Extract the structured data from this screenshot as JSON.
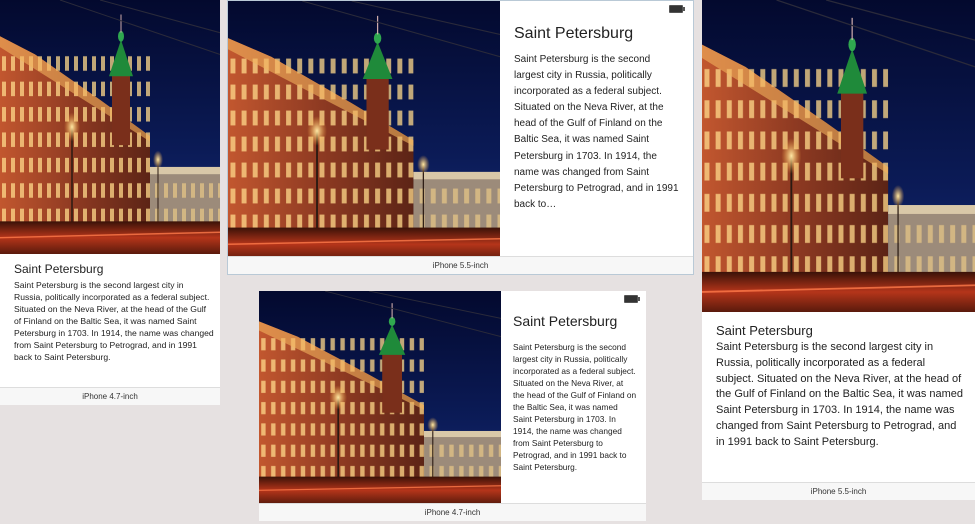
{
  "city": {
    "title": "Saint Petersburg",
    "description": "Saint Petersburg is the second largest city in Russia, politically incorporated as a federal subject. Situated on the Neva River, at the head of the Gulf of Finland on the Baltic Sea, it was named Saint Petersburg in 1703. In 1914, the name was changed from Saint Petersburg to Petrograd, and in 1991 back to Saint Petersburg.",
    "description_truncated": "Saint Petersburg is the second largest city in Russia, politically incorporated as a federal subject. Situated on the Neva River, at the head of the Gulf of Finland on the Baltic Sea, it was named Saint Petersburg in 1703. In 1914, the name was changed from Saint Petersburg to Petrograd, and in 1991 back to…"
  },
  "devices": {
    "d1_caption": "iPhone 4.7-inch",
    "d2_caption": "iPhone 5.5-inch",
    "d3_caption": "iPhone 4.7-inch",
    "d4_caption": "iPhone 5.5-inch"
  },
  "photo": {
    "subject": "Singer House, Nevsky Prospect at night",
    "icon": "city-photo"
  },
  "colors": {
    "sky": "#0b1b57",
    "building": "#a8452a",
    "street": "#c23c1d",
    "background": "#e6e1e1"
  }
}
